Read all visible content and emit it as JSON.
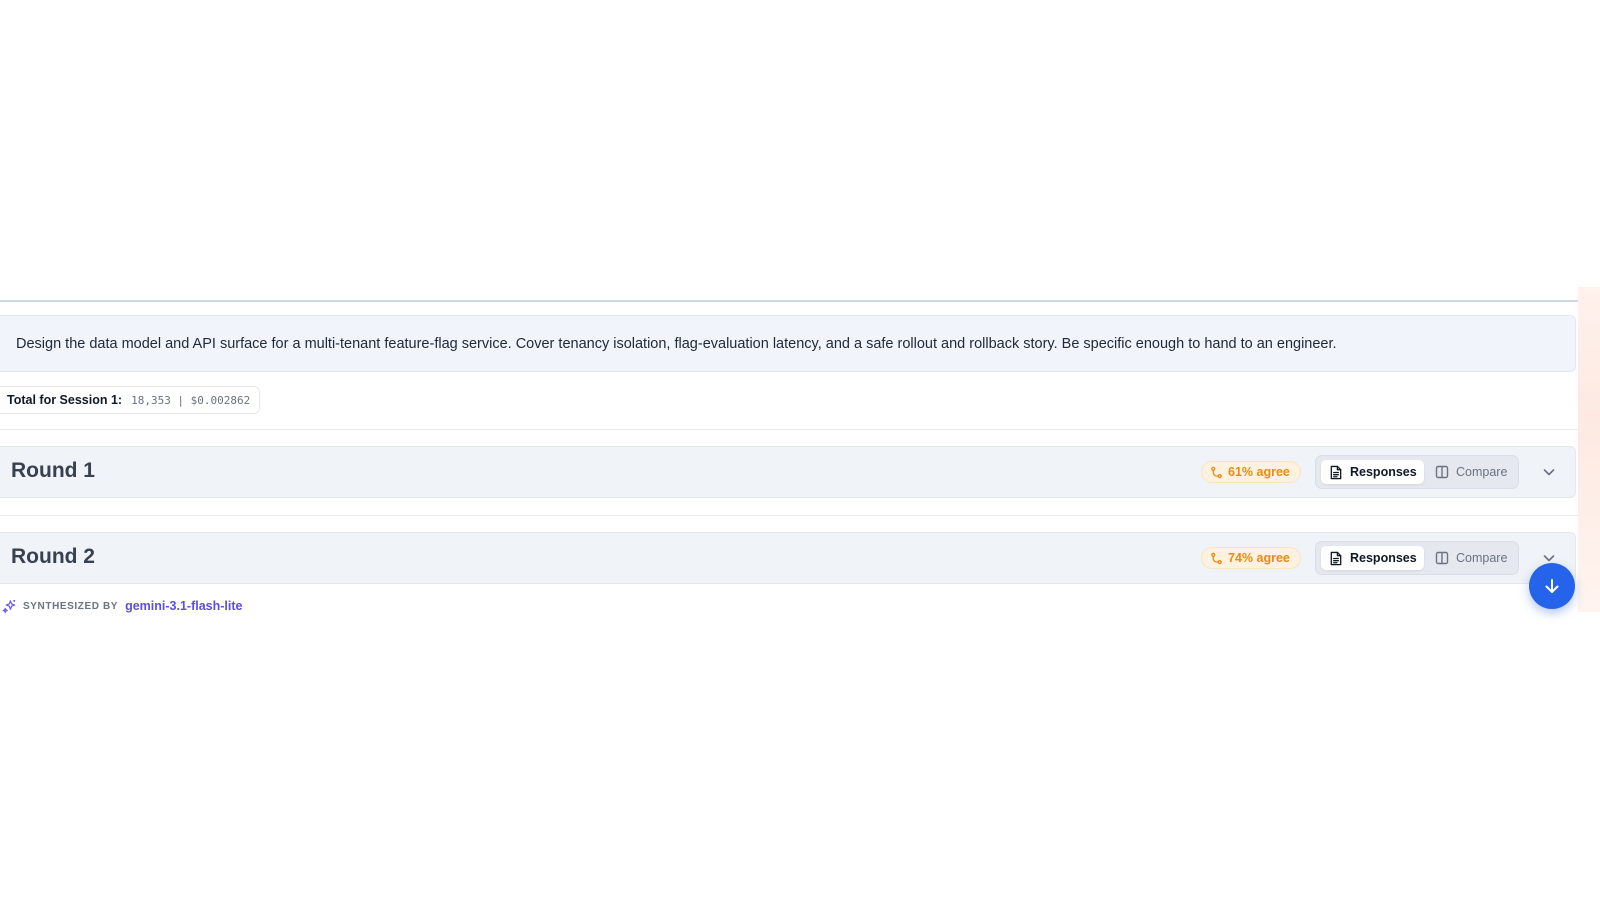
{
  "prompt": {
    "text": "Design the data model and API surface for a multi-tenant feature-flag service. Cover tenancy isolation, flag-evaluation latency, and a safe rollout and rollback story. Be specific enough to hand to an engineer."
  },
  "session_total": {
    "label": "Total for Session 1:",
    "value": "18,353 | $0.002862"
  },
  "rounds": [
    {
      "title": "Round 1",
      "agree": "61% agree",
      "responses_label": "Responses",
      "compare_label": "Compare"
    },
    {
      "title": "Round 2",
      "agree": "74% agree",
      "responses_label": "Responses",
      "compare_label": "Compare"
    }
  ],
  "synthesis": {
    "label": "SYNTHESIZED BY",
    "model": "gemini-3.1-flash-lite"
  },
  "icons": {
    "agree": "git-merge-icon",
    "responses": "document-icon",
    "compare": "columns-icon",
    "expand": "chevron-down-icon",
    "synth": "sparkles-icon",
    "scroll": "arrow-down-icon"
  },
  "colors": {
    "accent": "#2563eb",
    "agree_text": "#ea8c10",
    "agree_bg": "#fdf1e0",
    "synth_model": "#5b4ee6",
    "round_bg": "#f0f3f7",
    "prompt_bg": "#f1f4fb"
  }
}
